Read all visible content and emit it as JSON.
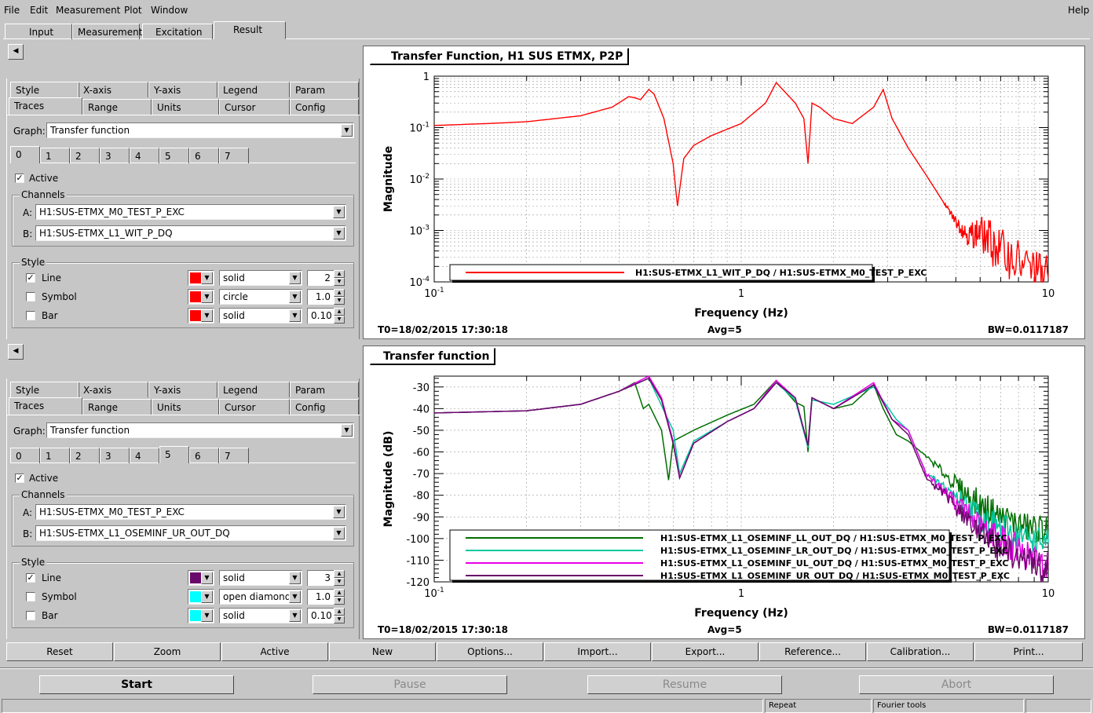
{
  "menu": {
    "file": "File",
    "edit": "Edit",
    "measurement": "Measurement",
    "plot": "Plot",
    "window": "Window",
    "help": "Help"
  },
  "main_tabs": [
    "Input",
    "Measurement",
    "Excitation",
    "Result"
  ],
  "panel_top": {
    "tabs_row1": [
      "Style",
      "X-axis",
      "Y-axis",
      "Legend",
      "Param"
    ],
    "tabs_row2": [
      "Traces",
      "Range",
      "Units",
      "Cursor",
      "Config"
    ],
    "graph_label": "Graph:",
    "graph_value": "Transfer function",
    "trace_tabs": [
      "0",
      "1",
      "2",
      "3",
      "4",
      "5",
      "6",
      "7"
    ],
    "active_label": "Active",
    "channels_label": "Channels",
    "a_label": "A:",
    "a_value": "H1:SUS-ETMX_M0_TEST_P_EXC",
    "b_label": "B:",
    "b_value": "H1:SUS-ETMX_L1_WIT_P_DQ",
    "style_label": "Style",
    "line_label": "Line",
    "line_style": "solid",
    "line_width": "2",
    "line_color": "#ff0000",
    "symbol_label": "Symbol",
    "symbol_style": "circle",
    "symbol_size": "1.0",
    "symbol_color": "#ff0000",
    "bar_label": "Bar",
    "bar_style": "solid",
    "bar_width": "0.10",
    "bar_color": "#ff0000"
  },
  "panel_bottom": {
    "tabs_row1": [
      "Style",
      "X-axis",
      "Y-axis",
      "Legend",
      "Param"
    ],
    "tabs_row2": [
      "Traces",
      "Range",
      "Units",
      "Cursor",
      "Config"
    ],
    "graph_label": "Graph:",
    "graph_value": "Transfer function",
    "trace_tabs": [
      "0",
      "1",
      "2",
      "3",
      "4",
      "5",
      "6",
      "7"
    ],
    "active_label": "Active",
    "channels_label": "Channels",
    "a_label": "A:",
    "a_value": "H1:SUS-ETMX_M0_TEST_P_EXC",
    "b_label": "B:",
    "b_value": "H1:SUS-ETMX_L1_OSEMINF_UR_OUT_DQ",
    "style_label": "Style",
    "line_label": "Line",
    "line_style": "solid",
    "line_width": "3",
    "line_color": "#6a0a6a",
    "symbol_label": "Symbol",
    "symbol_style": "open diamond",
    "symbol_size": "1.0",
    "symbol_color": "#00ffff",
    "bar_label": "Bar",
    "bar_style": "solid",
    "bar_width": "0.10",
    "bar_color": "#00ffff"
  },
  "plot_top": {
    "title": "Transfer Function, H1 SUS ETMX, P2P",
    "ylabel": "Magnitude",
    "xlabel": "Frequency (Hz)",
    "t0": "T0=18/02/2015 17:30:18",
    "avg": "Avg=5",
    "bw": "BW=0.0117187"
  },
  "plot_bottom": {
    "title": "Transfer function",
    "ylabel": "Magnitude (dB)",
    "xlabel": "Frequency (Hz)",
    "t0": "T0=18/02/2015 17:30:18",
    "avg": "Avg=5",
    "bw": "BW=0.0117187"
  },
  "bottom_buttons": [
    "Reset",
    "Zoom",
    "Active",
    "New",
    "Options...",
    "Import...",
    "Export...",
    "Reference...",
    "Calibration...",
    "Print..."
  ],
  "control": {
    "start": "Start",
    "pause": "Pause",
    "resume": "Resume",
    "abort": "Abort"
  },
  "status": {
    "repeat": "Repeat",
    "fourier": "Fourier tools"
  },
  "chart_data": [
    {
      "type": "line",
      "title": "Transfer Function, H1 SUS ETMX, P2P",
      "xlabel": "Frequency (Hz)",
      "ylabel": "Magnitude",
      "xscale": "log",
      "yscale": "log",
      "xlim": [
        0.1,
        10
      ],
      "ylim": [
        0.0001,
        1
      ],
      "x_ticks": [
        "10^-1",
        "1",
        "10"
      ],
      "y_ticks": [
        "1",
        "10^-1",
        "10^-2",
        "10^-3",
        "10^-4"
      ],
      "grid": true,
      "legend": "bottom",
      "series": [
        {
          "name": "H1:SUS-ETMX_L1_WIT_P_DQ / H1:SUS-ETMX_M0_TEST_P_EXC",
          "color": "#ff0000",
          "points": [
            [
              0.1,
              0.11
            ],
            [
              0.15,
              0.12
            ],
            [
              0.2,
              0.13
            ],
            [
              0.3,
              0.17
            ],
            [
              0.38,
              0.25
            ],
            [
              0.43,
              0.4
            ],
            [
              0.45,
              0.38
            ],
            [
              0.47,
              0.35
            ],
            [
              0.5,
              0.55
            ],
            [
              0.52,
              0.45
            ],
            [
              0.56,
              0.15
            ],
            [
              0.6,
              0.02
            ],
            [
              0.62,
              0.003
            ],
            [
              0.65,
              0.025
            ],
            [
              0.7,
              0.045
            ],
            [
              0.8,
              0.07
            ],
            [
              1.0,
              0.12
            ],
            [
              1.2,
              0.3
            ],
            [
              1.3,
              0.75
            ],
            [
              1.5,
              0.3
            ],
            [
              1.6,
              0.15
            ],
            [
              1.65,
              0.02
            ],
            [
              1.7,
              0.3
            ],
            [
              1.8,
              0.25
            ],
            [
              2.0,
              0.15
            ],
            [
              2.3,
              0.12
            ],
            [
              2.7,
              0.25
            ],
            [
              2.9,
              0.55
            ],
            [
              3.1,
              0.15
            ],
            [
              3.5,
              0.04
            ],
            [
              4.0,
              0.012
            ],
            [
              4.5,
              0.004
            ],
            [
              5.0,
              0.0015
            ],
            [
              5.5,
              0.0008
            ],
            [
              6.0,
              0.0009
            ],
            [
              7.0,
              0.0004
            ],
            [
              8.5,
              0.0002
            ],
            [
              10,
              0.00012
            ]
          ]
        }
      ]
    },
    {
      "type": "line",
      "title": "Transfer function",
      "xlabel": "Frequency (Hz)",
      "ylabel": "Magnitude (dB)",
      "xscale": "log",
      "xlim": [
        0.1,
        10
      ],
      "ylim": [
        -120,
        -25
      ],
      "y_ticks": [
        "-30",
        "-40",
        "-50",
        "-60",
        "-70",
        "-80",
        "-90",
        "-100",
        "-110",
        "-120"
      ],
      "x_ticks": [
        "10^-1",
        "1",
        "10"
      ],
      "grid": true,
      "legend": "bottom",
      "series": [
        {
          "name": "H1:SUS-ETMX_L1_OSEMINF_LL_OUT_DQ / H1:SUS-ETMX_M0_TEST_P_EXC",
          "color": "#006e00",
          "points": [
            [
              0.1,
              -42
            ],
            [
              0.2,
              -41
            ],
            [
              0.3,
              -38
            ],
            [
              0.4,
              -32
            ],
            [
              0.45,
              -28
            ],
            [
              0.48,
              -40
            ],
            [
              0.5,
              -38
            ],
            [
              0.55,
              -50
            ],
            [
              0.58,
              -73
            ],
            [
              0.6,
              -55
            ],
            [
              0.7,
              -50
            ],
            [
              0.9,
              -43
            ],
            [
              1.1,
              -38
            ],
            [
              1.3,
              -27
            ],
            [
              1.5,
              -37
            ],
            [
              1.6,
              -39
            ],
            [
              1.65,
              -60
            ],
            [
              1.7,
              -35
            ],
            [
              2.0,
              -40
            ],
            [
              2.3,
              -38
            ],
            [
              2.7,
              -29
            ],
            [
              2.9,
              -40
            ],
            [
              3.2,
              -52
            ],
            [
              3.5,
              -55
            ],
            [
              4.0,
              -62
            ],
            [
              5.0,
              -75
            ],
            [
              6.0,
              -85
            ],
            [
              7.0,
              -90
            ],
            [
              8.5,
              -95
            ],
            [
              10,
              -96
            ]
          ]
        },
        {
          "name": "H1:SUS-ETMX_L1_OSEMINF_LR_OUT_DQ / H1:SUS-ETMX_M0_TEST_P_EXC",
          "color": "#00c8a0",
          "points": [
            [
              0.1,
              -42
            ],
            [
              0.2,
              -41
            ],
            [
              0.3,
              -38
            ],
            [
              0.4,
              -32
            ],
            [
              0.5,
              -26
            ],
            [
              0.6,
              -50
            ],
            [
              0.63,
              -70
            ],
            [
              0.7,
              -55
            ],
            [
              0.9,
              -46
            ],
            [
              1.1,
              -40
            ],
            [
              1.3,
              -28
            ],
            [
              1.5,
              -36
            ],
            [
              1.65,
              -58
            ],
            [
              1.7,
              -36
            ],
            [
              2.0,
              -38
            ],
            [
              2.7,
              -30
            ],
            [
              3.2,
              -45
            ],
            [
              3.5,
              -50
            ],
            [
              4.0,
              -70
            ],
            [
              5.0,
              -80
            ],
            [
              6.0,
              -90
            ],
            [
              7.0,
              -95
            ],
            [
              8.5,
              -100
            ],
            [
              10,
              -102
            ]
          ]
        },
        {
          "name": "H1:SUS-ETMX_L1_OSEMINF_UL_OUT_DQ / H1:SUS-ETMX_M0_TEST_P_EXC",
          "color": "#e600e6",
          "points": [
            [
              0.1,
              -42
            ],
            [
              0.2,
              -41
            ],
            [
              0.3,
              -38
            ],
            [
              0.4,
              -32
            ],
            [
              0.5,
              -25
            ],
            [
              0.55,
              -35
            ],
            [
              0.6,
              -55
            ],
            [
              0.63,
              -72
            ],
            [
              0.7,
              -56
            ],
            [
              0.9,
              -46
            ],
            [
              1.1,
              -40
            ],
            [
              1.3,
              -27
            ],
            [
              1.5,
              -35
            ],
            [
              1.65,
              -57
            ],
            [
              1.7,
              -35
            ],
            [
              2.0,
              -40
            ],
            [
              2.7,
              -28
            ],
            [
              3.1,
              -45
            ],
            [
              3.5,
              -50
            ],
            [
              4.0,
              -70
            ],
            [
              5.0,
              -83
            ],
            [
              6.0,
              -95
            ],
            [
              7.0,
              -100
            ],
            [
              8.5,
              -108
            ],
            [
              10,
              -112
            ]
          ]
        },
        {
          "name": "H1:SUS-ETMX_L1_OSEMINF_UR_OUT_DQ / H1:SUS-ETMX_M0_TEST_P_EXC",
          "color": "#6a0a6a",
          "points": [
            [
              0.1,
              -42
            ],
            [
              0.2,
              -41
            ],
            [
              0.3,
              -38
            ],
            [
              0.4,
              -32
            ],
            [
              0.5,
              -26
            ],
            [
              0.55,
              -36
            ],
            [
              0.6,
              -56
            ],
            [
              0.63,
              -72
            ],
            [
              0.7,
              -56
            ],
            [
              0.9,
              -46
            ],
            [
              1.1,
              -40
            ],
            [
              1.3,
              -28
            ],
            [
              1.5,
              -35
            ],
            [
              1.65,
              -57
            ],
            [
              1.7,
              -35
            ],
            [
              2.0,
              -40
            ],
            [
              2.7,
              -29
            ],
            [
              3.1,
              -45
            ],
            [
              3.5,
              -52
            ],
            [
              4.0,
              -72
            ],
            [
              5.0,
              -85
            ],
            [
              6.0,
              -98
            ],
            [
              7.0,
              -105
            ],
            [
              8.5,
              -110
            ],
            [
              10,
              -115
            ]
          ]
        }
      ]
    }
  ]
}
